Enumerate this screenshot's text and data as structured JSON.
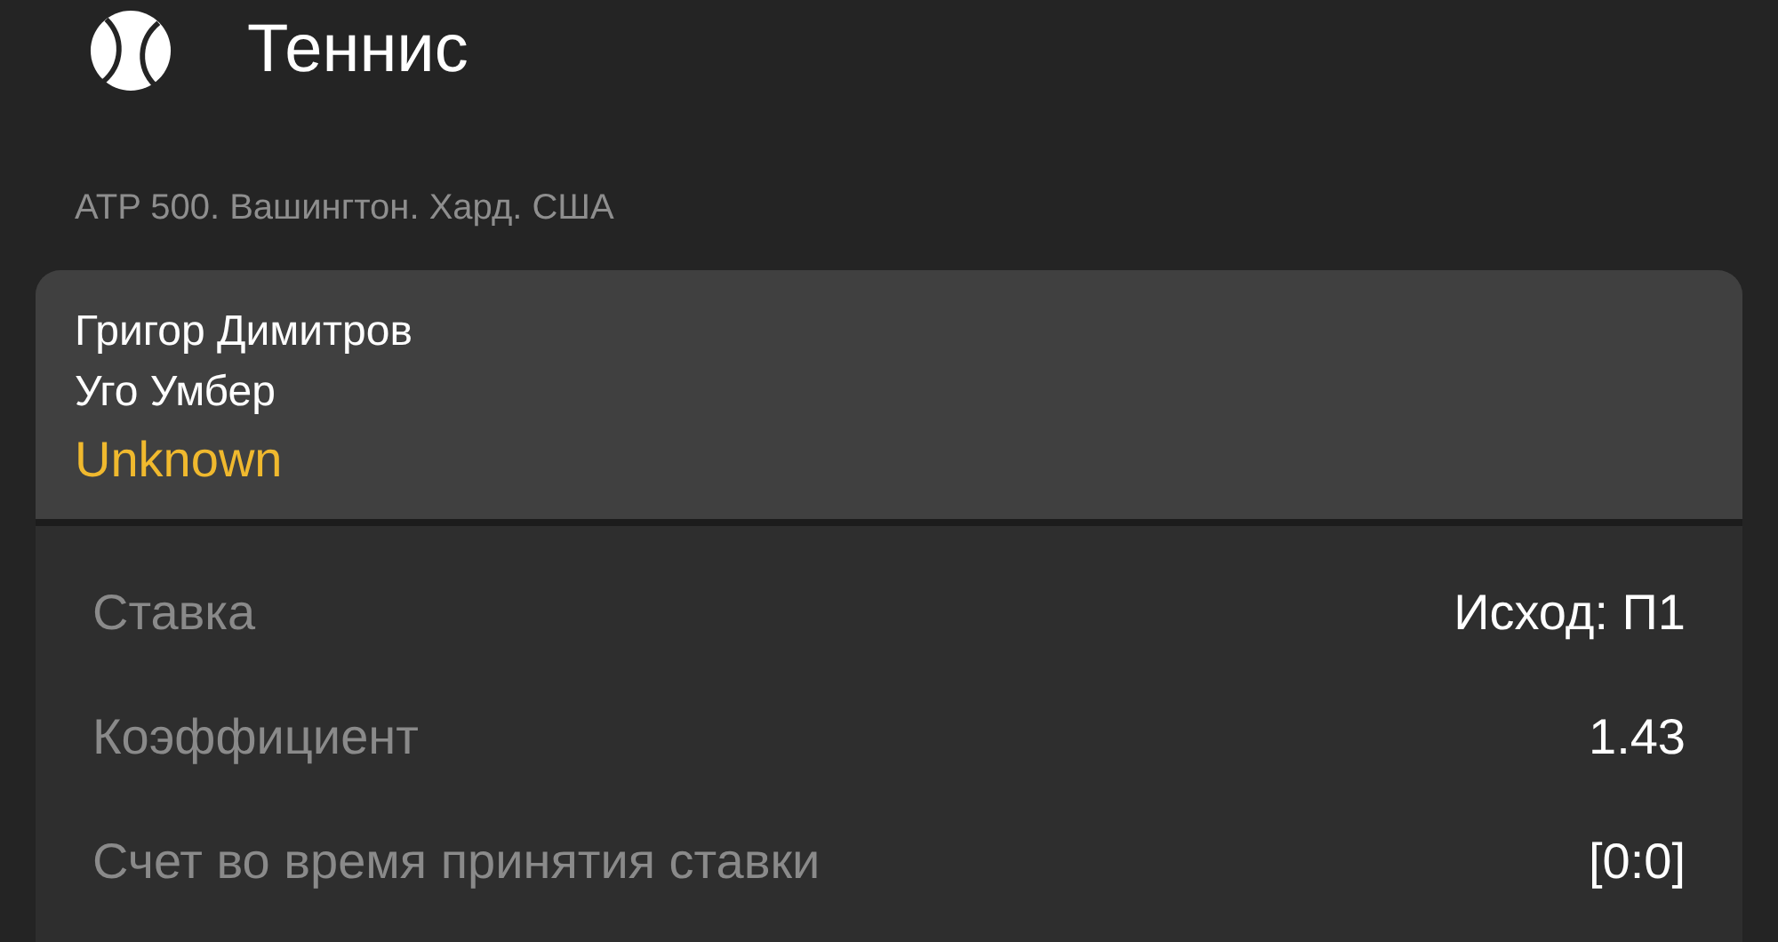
{
  "header": {
    "title": "Теннис"
  },
  "tournament": "ATP 500. Вашингтон. Хард. США",
  "match": {
    "players": [
      "Григор Димитров",
      "Уго Умбер"
    ],
    "status": "Unknown"
  },
  "details": [
    {
      "label": "Ставка",
      "value": "Исход: П1"
    },
    {
      "label": "Коэффициент",
      "value": "1.43"
    },
    {
      "label": "Счет во время принятия ставки",
      "value": "[0:0]"
    }
  ]
}
